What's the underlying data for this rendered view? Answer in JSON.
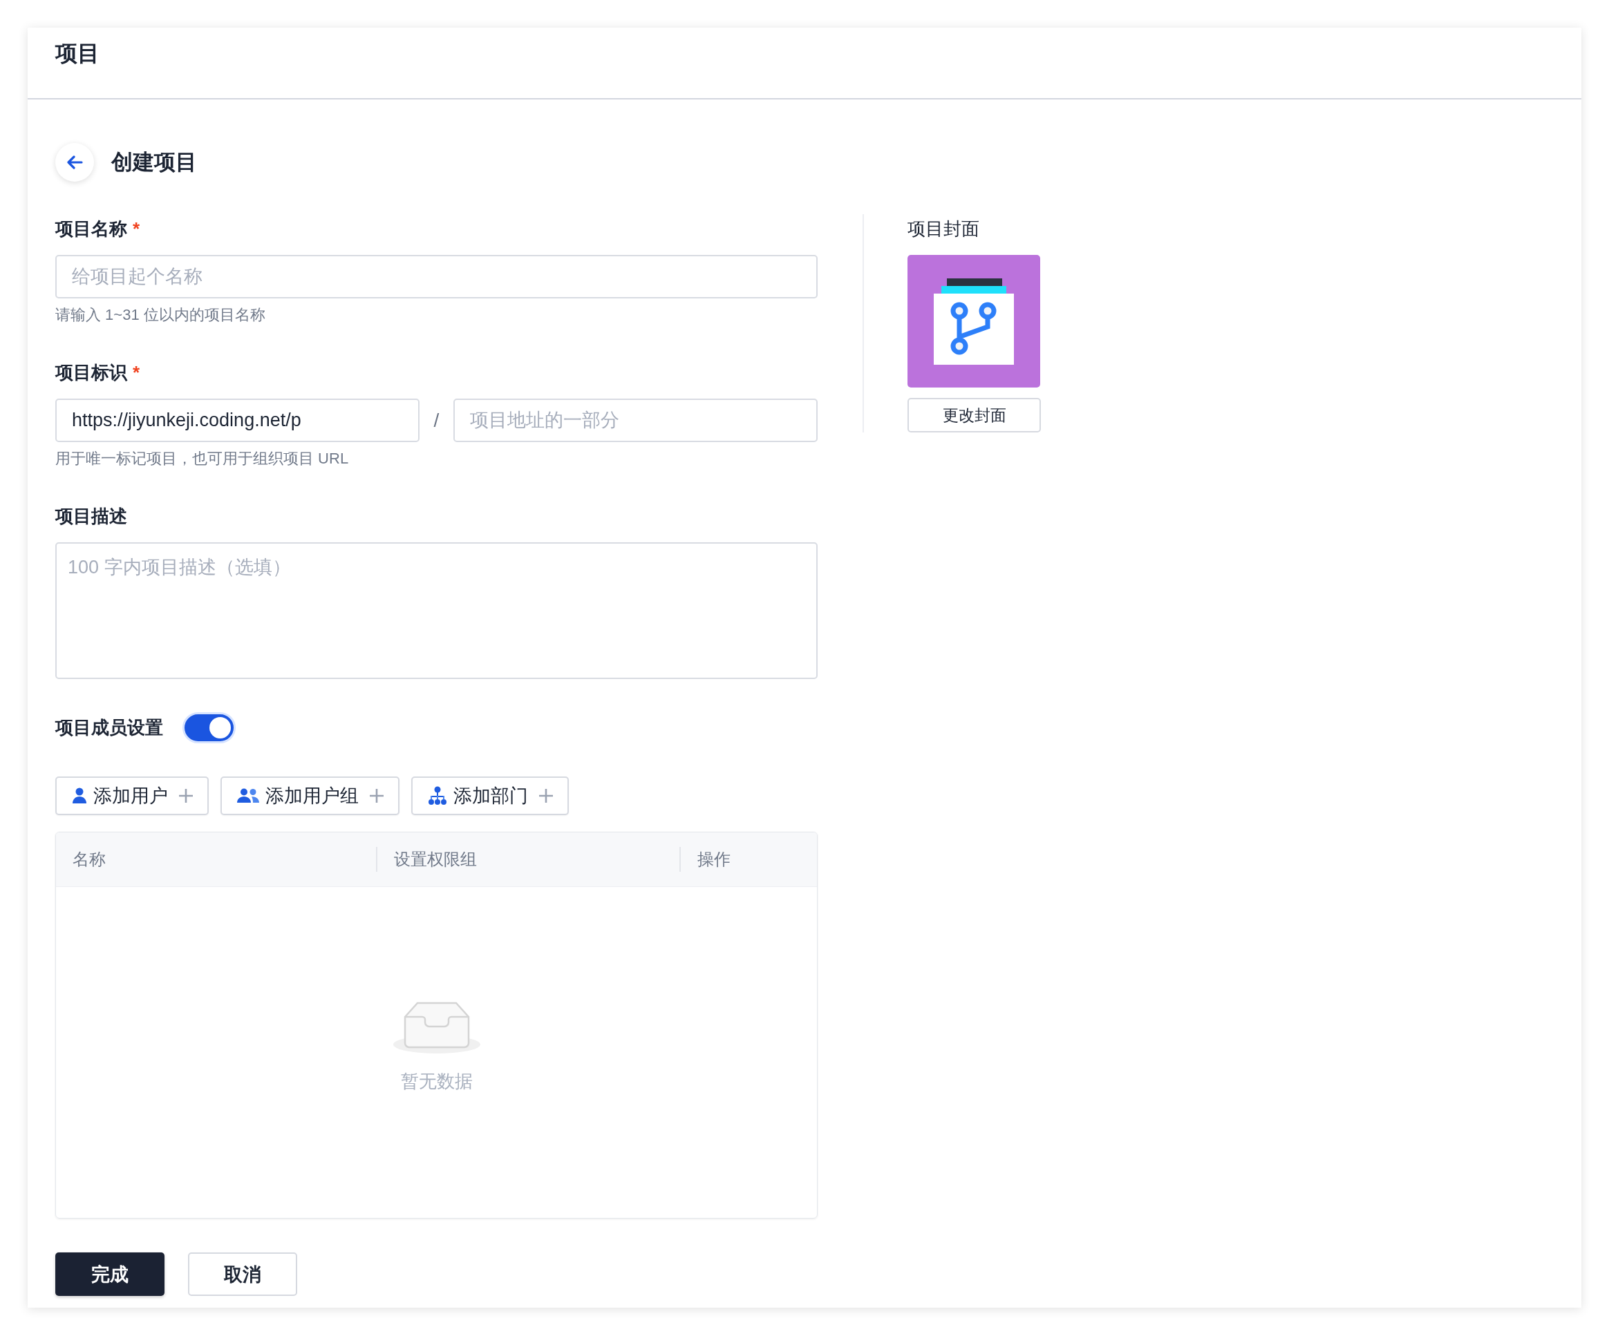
{
  "header": {
    "title": "项目"
  },
  "page": {
    "title": "创建项目"
  },
  "fields": [
    {
      "kind": "text",
      "label": "项目名称",
      "required_mark": "*",
      "placeholder": "给项目起个名称",
      "hint": "请输入 1~31 位以内的项目名称"
    },
    {
      "kind": "url",
      "label": "项目标识",
      "required_mark": "*",
      "prefix_value": "https://jiyunkeji.coding.net/p",
      "separator": "/",
      "placeholder": "项目地址的一部分",
      "hint": "用于唯一标记项目，也可用于组织项目 URL"
    },
    {
      "kind": "textarea",
      "label": "项目描述",
      "placeholder": "100 字内项目描述（选填）"
    }
  ],
  "members": {
    "label": "项目成员设置",
    "on": true,
    "add_buttons": [
      {
        "kind": "user",
        "label": "添加用户"
      },
      {
        "kind": "group",
        "label": "添加用户组"
      },
      {
        "kind": "department",
        "label": "添加部门"
      }
    ],
    "table": {
      "columns": [
        "名称",
        "设置权限组",
        "操作"
      ],
      "empty_text": "暂无数据"
    }
  },
  "cover": {
    "label": "项目封面",
    "button": "更改封面"
  },
  "actions": [
    {
      "kind": "primary",
      "label": "完成"
    },
    {
      "kind": "secondary",
      "label": "取消"
    }
  ]
}
